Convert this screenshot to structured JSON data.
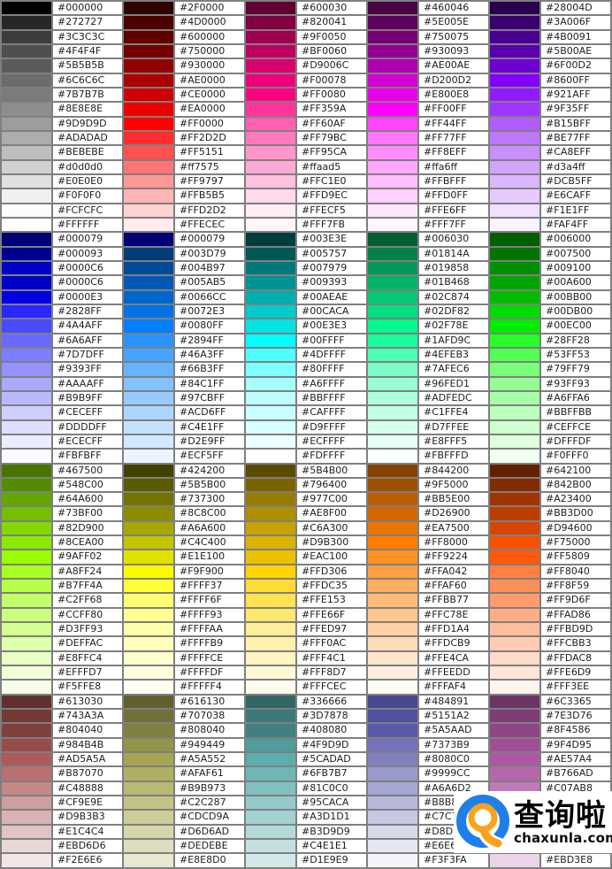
{
  "page": {
    "background": "#FFFFFF",
    "grid_line_color": "#7F7F7F",
    "label_text_color": "#1E1E1E"
  },
  "table": {
    "rows": 60,
    "columns": [
      {
        "id": "column-1",
        "cells": [
          "#000000",
          "#272727",
          "#3C3C3C",
          "#4F4F4F",
          "#5B5B5B",
          "#6C6C6C",
          "#7B7B7B",
          "#8E8E8E",
          "#9D9D9D",
          "#ADADAD",
          "#BEBEBE",
          "#d0d0d0",
          "#E0E0E0",
          "#F0F0F0",
          "#FCFCFC",
          "#FFFFFF",
          "#000079",
          "#000093",
          "#0000C6",
          "#0000C6",
          "#0000E3",
          "#2828FF",
          "#4A4AFF",
          "#6A6AFF",
          "#7D7DFF",
          "#9393FF",
          "#AAAAFF",
          "#B9B9FF",
          "#CECEFF",
          "#DDDDFF",
          "#ECECFF",
          "#FBFBFF",
          "#467500",
          "#548C00",
          "#64A600",
          "#73BF00",
          "#82D900",
          "#8CEA00",
          "#9AFF02",
          "#A8FF24",
          "#B7FF4A",
          "#C2FF68",
          "#CCFF80",
          "#D3FF93",
          "#DEFFAC",
          "#E8FFC4",
          "#EFFFD7",
          "#F5FFE8",
          "#613030",
          "#743A3A",
          "#804040",
          "#984B4B",
          "#AD5A5A",
          "#B87070",
          "#C48888",
          "#CF9E9E",
          "#D9B3B3",
          "#E1C4C4",
          "#EBD6D6",
          "#F2E6E6"
        ]
      },
      {
        "id": "column-2",
        "cells": [
          "#2F0000",
          "#4D0000",
          "#600000",
          "#750000",
          "#930000",
          "#AE0000",
          "#CE0000",
          "#EA0000",
          "#FF0000",
          "#FF2D2D",
          "#FF5151",
          "#ff7575",
          "#FF9797",
          "#FFB5B5",
          "#FFD2D2",
          "#FFECEC",
          "#000079",
          "#003D79",
          "#004B97",
          "#005AB5",
          "#0066CC",
          "#0072E3",
          "#0080FF",
          "#2894FF",
          "#46A3FF",
          "#66B3FF",
          "#84C1FF",
          "#97CBFF",
          "#ACD6FF",
          "#C4E1FF",
          "#D2E9FF",
          "#ECF5FF",
          "#424200",
          "#5B5B00",
          "#737300",
          "#8C8C00",
          "#A6A600",
          "#C4C400",
          "#E1E100",
          "#F9F900",
          "#FFFF37",
          "#FFFF6F",
          "#FFFF93",
          "#FFFFAA",
          "#FFFFB9",
          "#FFFFCE",
          "#FFFFDF",
          "#FFFFF4",
          "#616130",
          "#707038",
          "#808040",
          "#949449",
          "#A5A552",
          "#AFAF61",
          "#B9B973",
          "#C2C287",
          "#CDCD9A",
          "#D6D6AD",
          "#DEDEBE",
          "#E8E8D0"
        ]
      },
      {
        "id": "column-3",
        "cells": [
          "#600030",
          "#820041",
          "#9F0050",
          "#BF0060",
          "#D9006C",
          "#F00078",
          "#FF0080",
          "#FF359A",
          "#FF60AF",
          "#FF79BC",
          "#FF95CA",
          "#ffaad5",
          "#FFC1E0",
          "#FFD9EC",
          "#FFECF5",
          "#FFF7FB",
          "#003E3E",
          "#005757",
          "#007979",
          "#009393",
          "#00AEAE",
          "#00CACA",
          "#00E3E3",
          "#00FFFF",
          "#4DFFFF",
          "#80FFFF",
          "#A6FFFF",
          "#BBFFFF",
          "#CAFFFF",
          "#D9FFFF",
          "#ECFFFF",
          "#FDFFFF",
          "#5B4B00",
          "#796400",
          "#977C00",
          "#AE8F00",
          "#C6A300",
          "#D9B300",
          "#EAC100",
          "#FFD306",
          "#FFDC35",
          "#FFE153",
          "#FFE66F",
          "#FFED97",
          "#FFF0AC",
          "#FFF4C1",
          "#FFF8D7",
          "#FFFCEC",
          "#336666",
          "#3D7878",
          "#408080",
          "#4F9D9D",
          "#5CADAD",
          "#6FB7B7",
          "#81C0C0",
          "#95CACA",
          "#A3D1D1",
          "#B3D9D9",
          "#C4E1E1",
          "#D1E9E9"
        ]
      },
      {
        "id": "column-4",
        "cells": [
          "#460046",
          "#5E005E",
          "#750075",
          "#930093",
          "#AE00AE",
          "#D200D2",
          "#E800E8",
          "#FF00FF",
          "#FF44FF",
          "#FF77FF",
          "#FF8EFF",
          "#ffa6ff",
          "#FFBFFF",
          "#FFD0FF",
          "#FFE6FF",
          "#FFF7FF",
          "#006030",
          "#01814A",
          "#019858",
          "#01B468",
          "#02C874",
          "#02DF82",
          "#02F78E",
          "#1AFD9C",
          "#4EFEB3",
          "#7AFEC6",
          "#96FED1",
          "#ADFEDC",
          "#C1FFE4",
          "#D7FFEE",
          "#E8FFF5",
          "#FBFFFD",
          "#844200",
          "#9F5000",
          "#BB5E00",
          "#D26900",
          "#EA7500",
          "#FF8000",
          "#FF9224",
          "#FFA042",
          "#FFAF60",
          "#FFBB77",
          "#FFC78E",
          "#FFD1A4",
          "#FFDCB9",
          "#FFE4CA",
          "#FFEEDD",
          "#FFFAF4",
          "#484891",
          "#5151A2",
          "#5A5AAD",
          "#7373B9",
          "#8080C0",
          "#9999CC",
          "#A6A6D2",
          {
            "color": "#B8B8DC",
            "label": "#B8B8",
            "truncated_by_watermark": true
          },
          {
            "color": "#C7C7E2",
            "label": "#C7C7",
            "truncated_by_watermark": true
          },
          {
            "color": "#D8D8EB",
            "label": "#D8D8",
            "truncated_by_watermark": true
          },
          {
            "color": "#E6E6F2",
            "label": "#E6E6F",
            "truncated_by_watermark": true
          },
          "#F3F3FA"
        ]
      },
      {
        "id": "column-5",
        "cells": [
          "#28004D",
          "#3A006F",
          "#4B0091",
          "#5B00AE",
          "#6F00D2",
          "#8600FF",
          "#921AFF",
          "#9F35FF",
          "#B15BFF",
          "#BE77FF",
          "#CA8EFF",
          "#d3a4ff",
          "#DCB5FF",
          "#E6CAFF",
          "#F1E1FF",
          "#FAF4FF",
          "#006000",
          "#007500",
          "#009100",
          "#00A600",
          "#00BB00",
          "#00DB00",
          "#00EC00",
          "#28FF28",
          "#53FF53",
          "#79FF79",
          "#93FF93",
          "#A6FFA6",
          "#BBFFBB",
          "#CEFFCE",
          "#DFFFDF",
          "#F0FFF0",
          "#642100",
          "#842B00",
          "#A23400",
          "#BB3D00",
          "#D94600",
          "#F75000",
          "#FF5809",
          "#FF8040",
          "#FF8F59",
          "#FF9D6F",
          "#FFAD86",
          "#FFBD9D",
          "#FFCBB3",
          "#FFDAC8",
          "#FFE6D9",
          "#FFF3EE",
          "#6C3365",
          "#7E3D76",
          "#8F4586",
          "#9F4D95",
          "#AE57A4",
          "#B766AD",
          "#C07AB8",
          {
            "color": "#C98AC0",
            "label": "",
            "hidden_by_watermark": true
          },
          {
            "color": "#D39DCB",
            "label": "",
            "hidden_by_watermark": true
          },
          {
            "color": "#DDB3D8",
            "label": "",
            "hidden_by_watermark": true
          },
          {
            "color": "#E4C4E0",
            "label": "",
            "hidden_by_watermark": true
          },
          "#EBD3E8"
        ]
      }
    ]
  },
  "watermark": {
    "brand": "查询啦",
    "domain": "chaxunla.com",
    "logo_blue": "#1F7FE8",
    "logo_orange": "#F9A21A"
  }
}
